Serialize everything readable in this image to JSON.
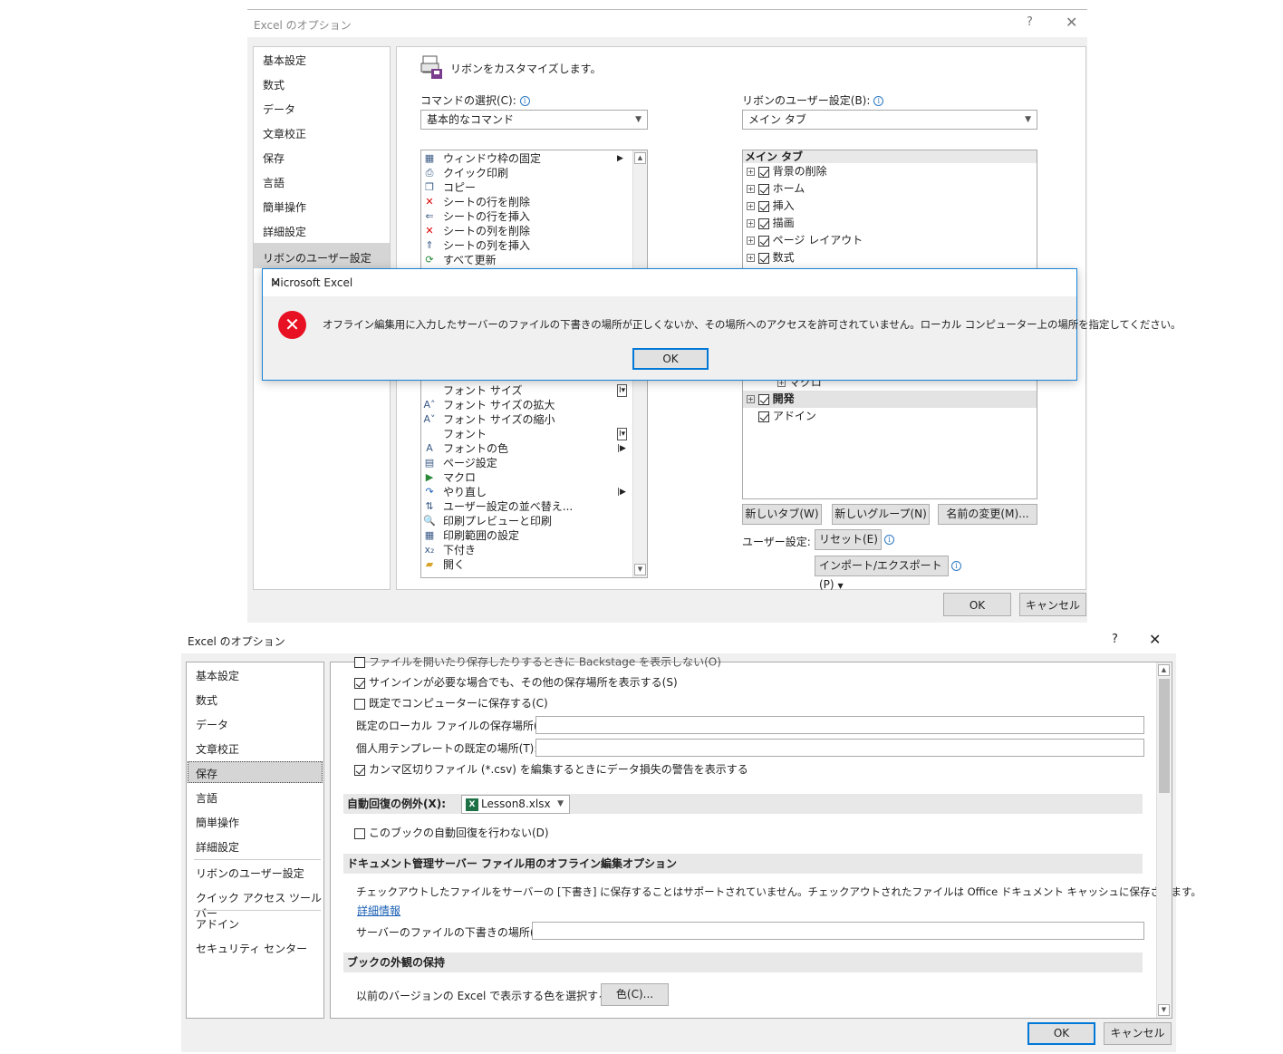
{
  "dialog1": {
    "title": "Excel のオプション",
    "help": "?",
    "close": "✕",
    "sidebar": [
      "基本設定",
      "数式",
      "データ",
      "文章校正",
      "保存",
      "言語",
      "簡単操作",
      "詳細設定",
      "リボンのユーザー設定"
    ],
    "heading": "リボンをカスタマイズします。",
    "commands_label": "コマンドの選択(C):",
    "commands_value": "基本的なコマンド",
    "ribbon_label": "リボンのユーザー設定(B):",
    "ribbon_value": "メイン タブ",
    "commands_top": [
      "ウィンドウ枠の固定",
      "クイック印刷",
      "コピー",
      "シートの行を削除",
      "シートの行を挿入",
      "シートの列を削除",
      "シートの列を挿入",
      "すべて更新"
    ],
    "commands_bottom": [
      "フォント サイズ",
      "フォント サイズの拡大",
      "フォント サイズの縮小",
      "フォント",
      "フォントの色",
      "ページ設定",
      "マクロ",
      "やり直し",
      "ユーザー設定の並べ替え...",
      "印刷プレビューと印刷",
      "印刷範囲の設定",
      "下付き",
      "開く"
    ],
    "tabs_header": "メイン タブ",
    "tabs_top": [
      "背景の削除",
      "ホーム",
      "挿入",
      "描画",
      "ページ レイアウト",
      "数式"
    ],
    "tabs_partial": "マクロ",
    "tab_dev": "開発",
    "tab_addin": "アドイン",
    "new_tab": "新しいタブ(W)",
    "new_group": "新しいグループ(N)",
    "rename": "名前の変更(M)...",
    "user_settings_label": "ユーザー設定:",
    "reset": "リセット(E)",
    "import_export": "インポート/エクスポート(P)",
    "ok": "OK",
    "cancel": "キャンセル"
  },
  "messagebox": {
    "title": "Microsoft Excel",
    "close": "✕",
    "icon": "error-icon",
    "message": "オフライン編集用に入力したサーバーのファイルの下書きの場所が正しくないか、その場所へのアクセスを許可されていません。ローカル コンピューター上の場所を指定してください。",
    "ok": "OK"
  },
  "dialog2": {
    "title": "Excel のオプション",
    "help": "?",
    "close": "✕",
    "sidebar": [
      "基本設定",
      "数式",
      "データ",
      "文章校正",
      "保存",
      "言語",
      "簡単操作",
      "詳細設定",
      "リボンのユーザー設定",
      "クイック アクセス ツール バー",
      "アドイン",
      "セキュリティ センター"
    ],
    "opt_partial": "ファイルを開いたり保存したりするときに Backstage を表示しない(O)",
    "opt_signin": "サインインが必要な場合でも、その他の保存場所を表示する(S)",
    "opt_savepc": "既定でコンピューターに保存する(C)",
    "label_local": "既定のローカル ファイルの保存場所(I):",
    "label_template": "個人用テンプレートの既定の場所(T):",
    "opt_csv": "カンマ区切りファイル (*.csv) を編集するときにデータ損失の警告を表示する",
    "autorecover_label": "自動回復の例外(X):",
    "autorecover_file": "Lesson8.xlsx",
    "opt_noautorecover": "このブックの自動回復を行わない(D)",
    "sect_dms": "ドキュメント管理サーバー ファイル用のオフライン編集オプション",
    "dms_text": "チェックアウトしたファイルをサーバーの [下書き] に保存することはサポートされていません。チェックアウトされたファイルは Office ドキュメント キャッシュに保存されます。",
    "dms_link": "詳細情報",
    "label_drafts": "サーバーのファイルの下書きの場所(V):",
    "sect_look": "ブックの外観の保持",
    "color_label": "以前のバージョンの Excel で表示する色を選択する:",
    "color_btn": "色(C)...",
    "ok": "OK",
    "cancel": "キャンセル"
  }
}
